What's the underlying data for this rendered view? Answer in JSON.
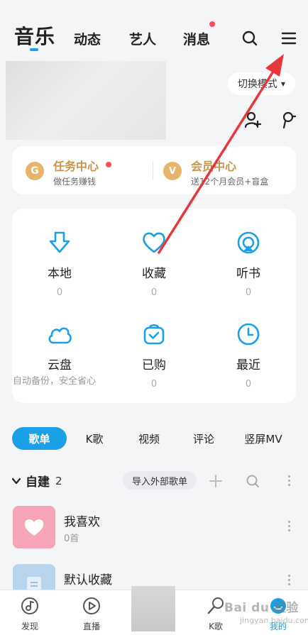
{
  "topnav": {
    "tabs": [
      "音乐",
      "动态",
      "艺人",
      "消息"
    ],
    "accent": "#1aa0e6",
    "badge_color": "#ff4d5a"
  },
  "mode_switch": {
    "label": "切换模式"
  },
  "vip_bar": {
    "task": {
      "title": "任务中心",
      "sub": "做任务赚钱"
    },
    "member": {
      "title": "会员中心",
      "sub": "送12个月会员+盲盒"
    }
  },
  "grid": [
    {
      "label": "本地",
      "count": "0",
      "icon": "download-icon"
    },
    {
      "label": "收藏",
      "count": "0",
      "icon": "heart-icon"
    },
    {
      "label": "听书",
      "count": "0",
      "icon": "audiobook-icon"
    },
    {
      "label": "云盘",
      "count": "",
      "icon": "cloud-icon"
    },
    {
      "label": "已购",
      "count": "0",
      "icon": "purchased-bag-icon"
    },
    {
      "label": "最近",
      "count": "0",
      "icon": "clock-icon"
    }
  ],
  "cloud_hint": "自动备份，安全省心",
  "categories": [
    "歌单",
    "K歌",
    "视频",
    "评论",
    "竖屏MV"
  ],
  "section": {
    "title": "自建",
    "count": "2",
    "import_label": "导入外部歌单"
  },
  "playlists": [
    {
      "title": "我喜欢",
      "sub": "0首",
      "cover_color": "#f7a4b9"
    },
    {
      "title": "默认收藏",
      "sub": "",
      "cover_color": "#b9d4ef"
    }
  ],
  "bottom_nav": [
    {
      "label": "发现",
      "icon": "discover-icon"
    },
    {
      "label": "直播",
      "icon": "live-icon"
    },
    {
      "label": "K歌",
      "icon": "karaoke-icon"
    },
    {
      "label": "我的",
      "icon": "me-icon"
    }
  ],
  "watermark": {
    "text": "Bai du 经验",
    "sub": "jingyan.baidu.com"
  },
  "annotation_color": "#e8373a"
}
